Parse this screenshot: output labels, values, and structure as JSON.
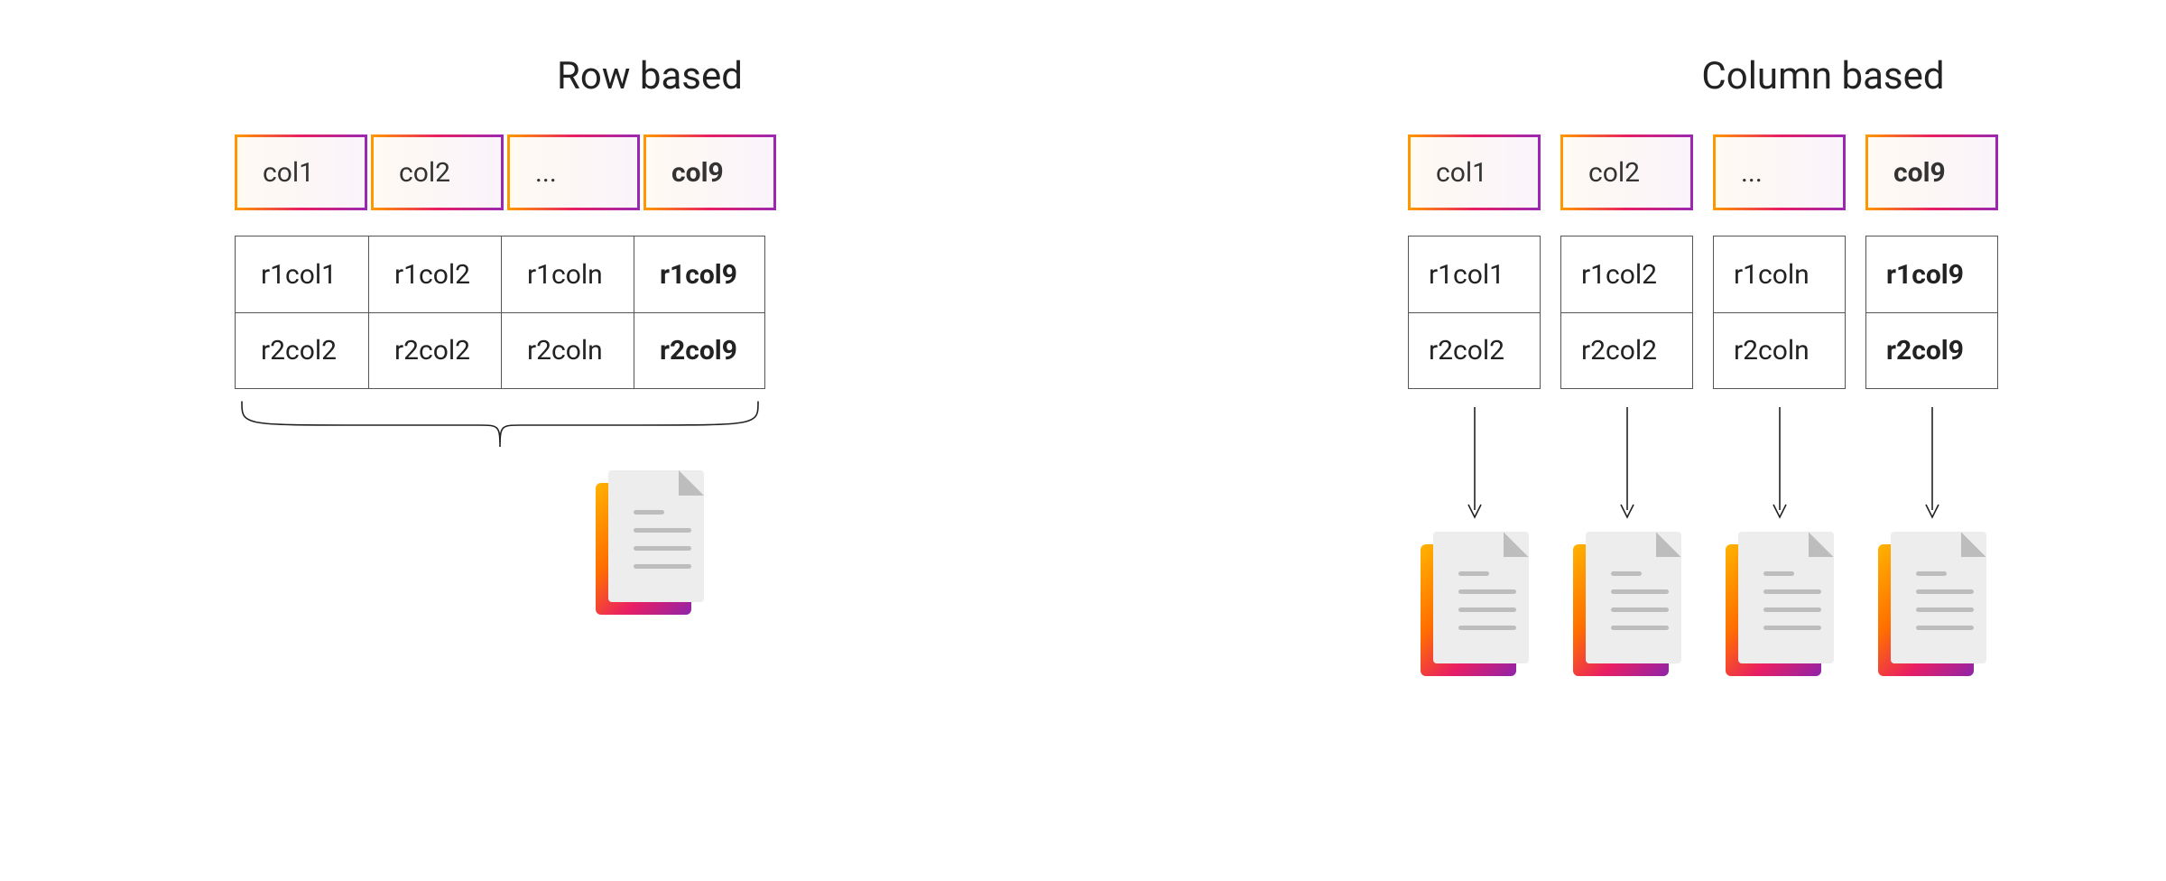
{
  "left": {
    "title": "Row based",
    "headers": [
      "col1",
      "col2",
      "...",
      "col9"
    ],
    "rows": [
      [
        "r1col1",
        "r1col2",
        "r1coln",
        "r1col9"
      ],
      [
        "r2col2",
        "r2col2",
        "r2coln",
        "r2col9"
      ]
    ]
  },
  "right": {
    "title": "Column based",
    "headers": [
      "col1",
      "col2",
      "...",
      "col9"
    ],
    "columns": [
      [
        "r1col1",
        "r2col2"
      ],
      [
        "r1col2",
        "r2col2"
      ],
      [
        "r1coln",
        "r2coln"
      ],
      [
        "r1col9",
        "r2col9"
      ]
    ]
  }
}
